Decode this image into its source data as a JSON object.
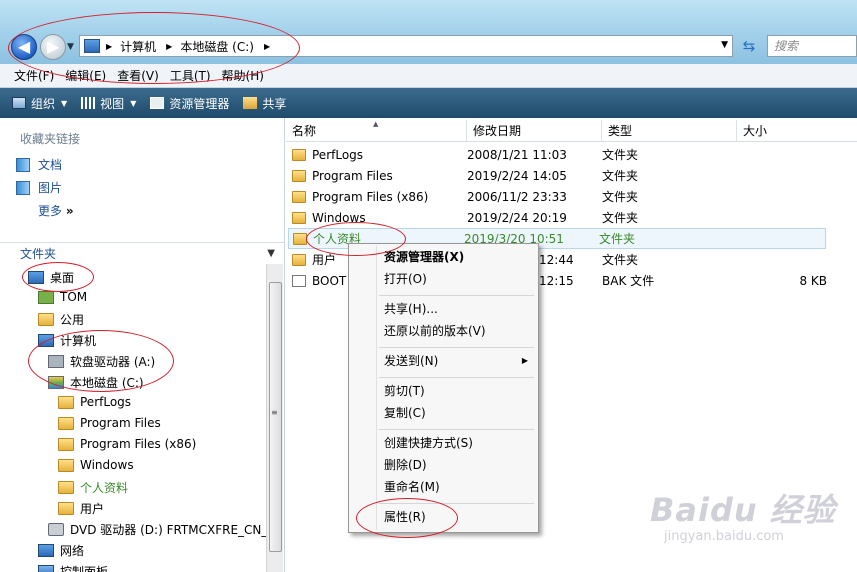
{
  "address": {
    "crumbs": [
      "计算机",
      "本地磁盘 (C:)"
    ],
    "search_placeholder": "搜索"
  },
  "menubar": [
    "文件(F)",
    "编辑(E)",
    "查看(V)",
    "工具(T)",
    "帮助(H)"
  ],
  "toolbar": {
    "organize": "组织",
    "views": "视图",
    "explorer": "资源管理器",
    "share": "共享"
  },
  "sidebar": {
    "favorites_header": "收藏夹链接",
    "favorites": [
      "文档",
      "图片"
    ],
    "more": "更多",
    "folders_header": "文件夹",
    "tree": [
      "桌面",
      "TOM",
      "公用",
      "计算机",
      "软盘驱动器 (A:)",
      "本地磁盘 (C:)",
      "PerfLogs",
      "Program Files",
      "Program Files (x86)",
      "Windows",
      "个人资料",
      "用户",
      "DVD 驱动器 (D:) FRTMCXFRE_CN_I",
      "网络",
      "控制面板"
    ]
  },
  "columns": [
    "名称",
    "修改日期",
    "类型",
    "大小"
  ],
  "files": [
    {
      "name": "PerfLogs",
      "date": "2008/1/21 11:03",
      "type": "文件夹",
      "size": ""
    },
    {
      "name": "Program Files",
      "date": "2019/2/24 14:05",
      "type": "文件夹",
      "size": ""
    },
    {
      "name": "Program Files (x86)",
      "date": "2006/11/2 23:33",
      "type": "文件夹",
      "size": ""
    },
    {
      "name": "Windows",
      "date": "2019/2/24 20:19",
      "type": "文件夹",
      "size": ""
    },
    {
      "name": "个人资料",
      "date": "2019/3/20 10:51",
      "type": "文件夹",
      "size": ""
    },
    {
      "name": "用户",
      "date": "12:44",
      "type": "文件夹",
      "size": ""
    },
    {
      "name": "BOOT",
      "date": "12:15",
      "type": "BAK 文件",
      "size": "8 KB"
    }
  ],
  "context_menu": [
    "资源管理器(X)",
    "打开(O)",
    "共享(H)...",
    "还原以前的版本(V)",
    "发送到(N)",
    "剪切(T)",
    "复制(C)",
    "创建快捷方式(S)",
    "删除(D)",
    "重命名(M)",
    "属性(R)"
  ],
  "watermark": {
    "brand": "Baidu 经验",
    "url": "jingyan.baidu.com"
  },
  "colors": {
    "annotation": "#d41e2a",
    "selected_text": "#3a8a2a",
    "toolbar": "#2a5578"
  }
}
